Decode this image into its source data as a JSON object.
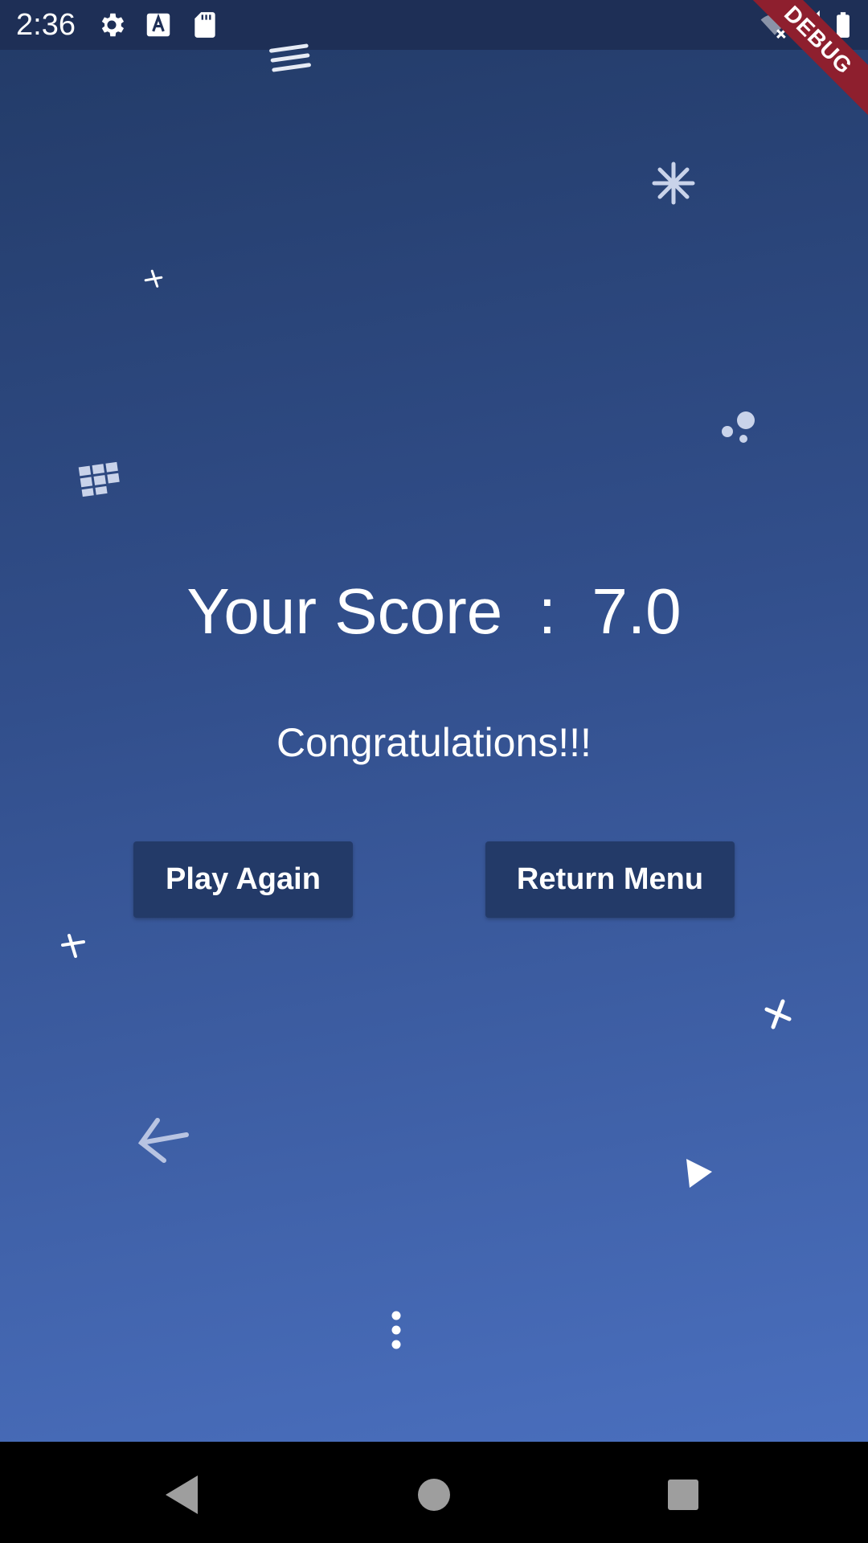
{
  "status_bar": {
    "time": "2:36",
    "icons": [
      "settings-icon",
      "text-a-icon",
      "sd-card-icon",
      "wifi-off-icon",
      "signal-icon",
      "battery-icon"
    ]
  },
  "debug_banner": "DEBUG",
  "score": {
    "text": "Your Score  :  7.0"
  },
  "message": "Congratulations!!!",
  "buttons": {
    "play_again": "Play Again",
    "return_menu": "Return Menu"
  },
  "decorations": [
    "lines-icon",
    "snowflake-icon",
    "cross-icon",
    "dots-icon",
    "grid-icon",
    "cross-icon",
    "cross-icon",
    "arrow-left-icon",
    "play-triangle-icon",
    "vertical-dots-icon"
  ],
  "nav_bar": {
    "icons": [
      "back-triangle-icon",
      "home-circle-icon",
      "recents-square-icon"
    ]
  },
  "colors": {
    "background_top": "#223a66",
    "background_bottom": "#4a6fbe",
    "button": "#233a68",
    "debug_banner": "#8e1f2e"
  }
}
